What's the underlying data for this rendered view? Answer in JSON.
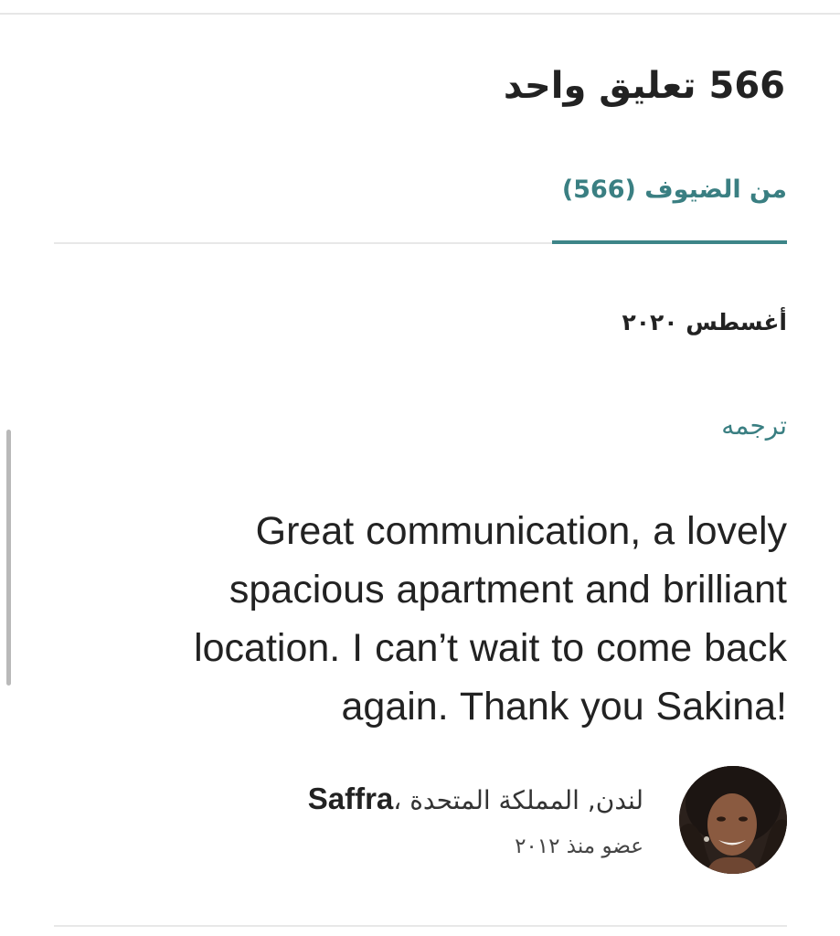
{
  "header": {
    "title": "566 تعليق واحد"
  },
  "tabs": [
    {
      "label": "من الضيوف (566)",
      "active": true
    }
  ],
  "review": {
    "date": "أغسطس ٢٠٢٠",
    "translate_label": "ترجمه",
    "text": "Great communication, a lovely spacious apartment and brilliant location. I can’t wait to come back again. Thank you Sakina!",
    "reviewer": {
      "name": "Saffra",
      "separator": "، ",
      "location": "لندن, المملكة المتحدة",
      "member_since": "عضو منذ ٢٠١٢"
    }
  },
  "colors": {
    "accent": "#3d8588",
    "text": "#222222",
    "divider": "#e8e8e8"
  }
}
